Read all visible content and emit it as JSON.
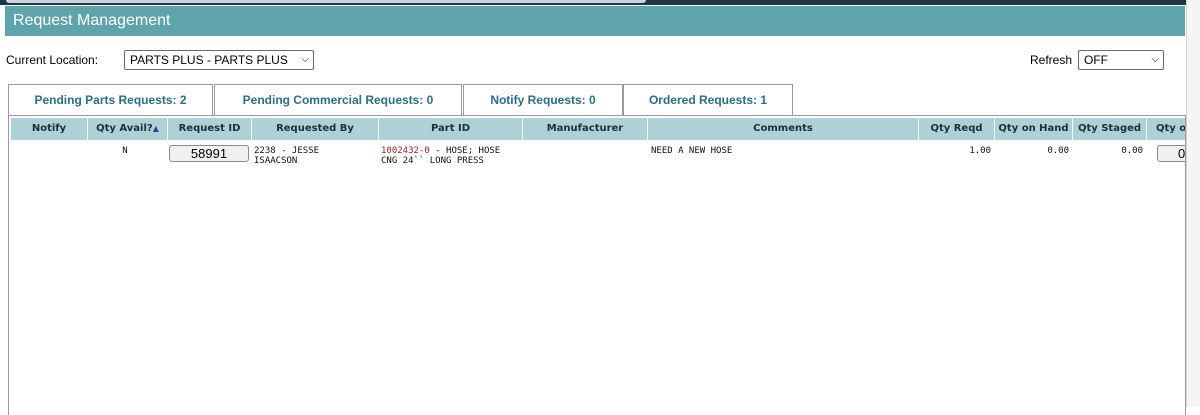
{
  "header": {
    "title": "Request Management"
  },
  "location": {
    "label": "Current Location:",
    "value": "PARTS PLUS - PARTS PLUS"
  },
  "refresh": {
    "label": "Refresh",
    "value": "OFF"
  },
  "tabs": [
    {
      "label": "Pending Parts Requests: 2"
    },
    {
      "label": "Pending Commercial Requests: 0"
    },
    {
      "label": "Notify Requests: 0"
    },
    {
      "label": "Ordered Requests: 1"
    }
  ],
  "table": {
    "columns": [
      "Notify",
      "Qty Avail?",
      "Request ID",
      "Requested By",
      "Part ID",
      "Manufacturer",
      "Comments",
      "Qty Reqd",
      "Qty on Hand",
      "Qty Staged",
      "Qty o"
    ],
    "sort_icon": "▲",
    "rows": [
      {
        "notify": "",
        "qty_avail": "N",
        "request_id": "58991",
        "requested_by_line1": "2238 - JESSE",
        "requested_by_line2": "ISAACSON",
        "part_no": "1002432-0",
        "part_desc_line1": " - HOSE; HOSE",
        "part_desc_line2": "CNG 24`` LONG PRESS",
        "manufacturer": "",
        "comments": "NEED A NEW HOSE",
        "qty_reqd": "1.00",
        "qty_on_hand": "0.00",
        "qty_staged": "0.00",
        "qty_ordered": "0"
      }
    ]
  }
}
